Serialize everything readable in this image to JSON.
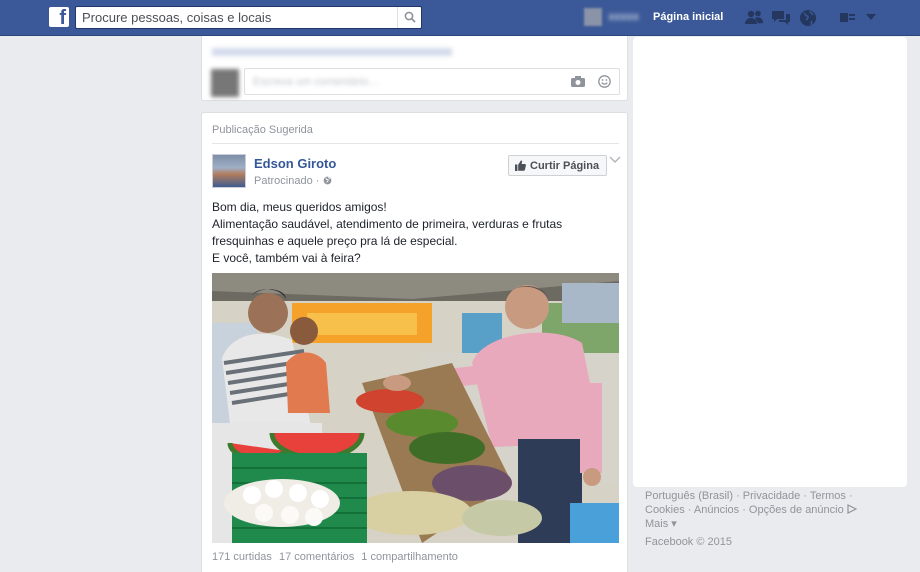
{
  "topbar": {
    "logo": "f",
    "search_placeholder": "Procure pessoas, coisas e locais",
    "home_label": "Página inicial",
    "icons": [
      "friends-icon",
      "messages-icon",
      "notifications-globe-icon",
      "privacy-icon",
      "account-menu-icon"
    ],
    "color": "#3b5998"
  },
  "post": {
    "suggested_label": "Publicação Sugerida",
    "author": "Edson Giroto",
    "sponsored": "Patrocinado ·",
    "like_page_label": "Curtir Página",
    "text": [
      "Bom dia, meus queridos amigos!",
      "Alimentação saudável, atendimento de primeira, verduras e frutas",
      "fresquinhas e aquele preço pra lá de especial.",
      "E você, também vai à feira?"
    ],
    "stats": {
      "likes": "171 curtidas",
      "comments": "17 comentários",
      "shares": "1 compartilhamento"
    }
  },
  "footer": {
    "row1": "Português (Brasil) · Privacidade · Termos ·",
    "row2": "Cookies · Anúncios · Opções de anúncio",
    "row3": "Mais ▾",
    "copyright": "Facebook © 2015"
  },
  "colors": {
    "link": "#365899",
    "muted": "#90949c",
    "background": "#e9ebee"
  }
}
